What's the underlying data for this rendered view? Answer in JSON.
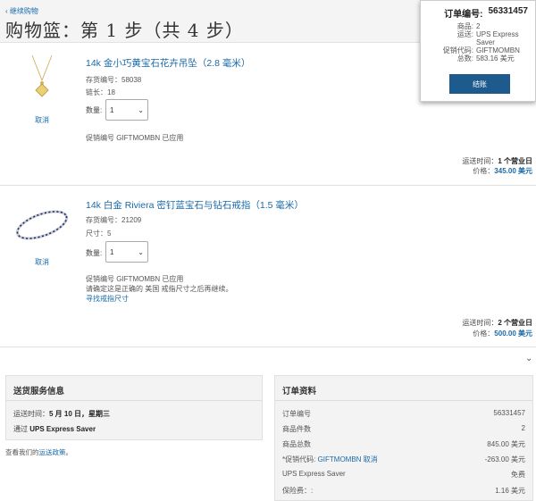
{
  "header": {
    "back_link": "‹ 继续购物",
    "title": "购物篮：第 1 步（共 4 步）"
  },
  "summary": {
    "order_label": "订单编号:",
    "order_number": "56331457",
    "items_label": "商品:",
    "items_value": "2",
    "ship_label": "运送:",
    "ship_value_1": "UPS Express",
    "ship_value_2": "Saver",
    "promo_label": "促销代码:",
    "promo_value": "GIFTMOMBN",
    "total_label": "总数:",
    "total_value": "583.16 美元",
    "checkout_button": "结账"
  },
  "items": [
    {
      "name": "14k 金小巧黄宝石花卉吊坠（2.8 毫米）",
      "stock": "存货编号：58038",
      "attr": "链长：18",
      "qty_label": "数量:",
      "qty_value": "1",
      "remove": "取消",
      "promo": "促销编号 GIFTMOMBN 已应用",
      "ship": "运送时间：",
      "ship_days": "1 个营业日",
      "price_label": "价格：",
      "price": "345.00 美元"
    },
    {
      "name": "14k 白金 Riviera 密钉蓝宝石与钻石戒指（1.5 毫米）",
      "stock": "存货编号：21209",
      "attr": "尺寸：5",
      "qty_label": "数量:",
      "qty_value": "1",
      "remove": "取消",
      "promo": "促销编号 GIFTMOMBN 已应用",
      "note": "请确定这是正确的 美国 戒指尺寸之后再继续。",
      "size_link": "寻找戒指尺寸",
      "ship": "运送时间：",
      "ship_days": "2 个营业日",
      "price_label": "价格：",
      "price": "500.00 美元"
    }
  ],
  "shipping_panel": {
    "title": "送货服务信息",
    "time_label": "运送时间：",
    "time_value": "5 月 10 日，星期三",
    "via_label": "通过",
    "via_value": "UPS Express Saver",
    "policy_text": "查看我们的",
    "policy_link": "运送政策",
    "policy_end": "。"
  },
  "order_panel": {
    "title": "订单资料",
    "rows": [
      {
        "label": "订单编号",
        "value": "56331457"
      },
      {
        "label": "商品件数",
        "value": "2"
      },
      {
        "label": "商品总数",
        "value": "845.00 美元"
      },
      {
        "label": "*促销代码: ",
        "link": "GIFTMOMBN 取消",
        "value": "-263.00 美元"
      },
      {
        "label": "UPS Express Saver",
        "value": "免费"
      },
      {
        "label": "保险费：:",
        "value": "1.16 美元"
      }
    ]
  },
  "colors": {
    "accent": "#1a6aa8",
    "button": "#1d5a8e"
  }
}
